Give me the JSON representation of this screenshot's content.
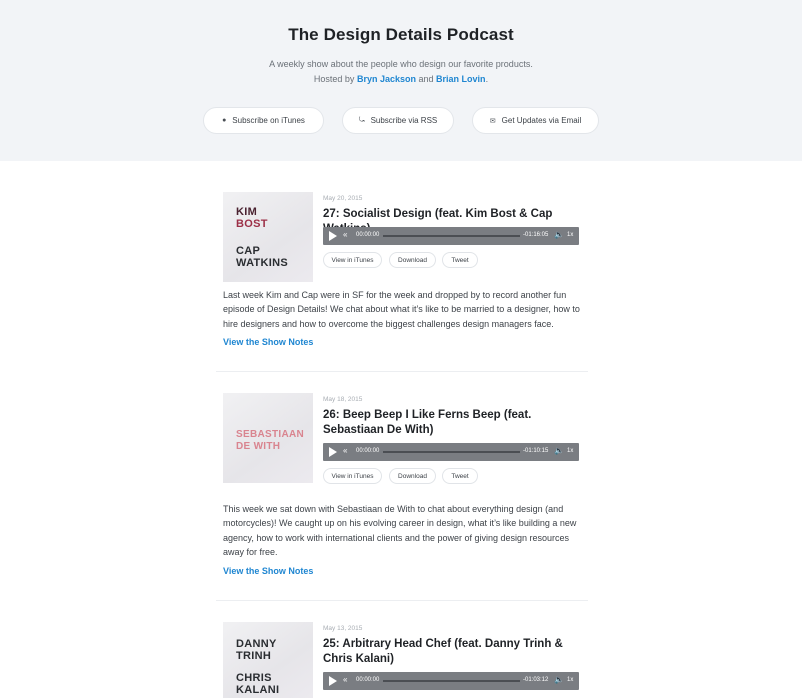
{
  "header": {
    "title": "The Design Details Podcast",
    "tagline": "A weekly show about the people who design our favorite products.",
    "hosted_by": "Hosted by",
    "host1": "Bryn Jackson",
    "and": "and",
    "host2": "Brian Lovin",
    "period": "."
  },
  "subscribe": [
    {
      "label": "Subscribe on iTunes",
      "icon": "microphone-icon",
      "glyph": "🎙"
    },
    {
      "label": "Subscribe via RSS",
      "icon": "rss-icon",
      "glyph": "⌔"
    },
    {
      "label": "Get Updates via Email",
      "icon": "envelope-icon",
      "glyph": "✉"
    }
  ],
  "episodes": [
    {
      "date": "May 20, 2015",
      "title": "27: Socialist Design (feat. Kim Bost & Cap Watkins)",
      "cover_lines_top": [
        "KIM",
        "BOST"
      ],
      "cover_lines_bottom": [
        "CAP",
        "WATKINS"
      ],
      "player": {
        "current": "00:00:00",
        "duration": "-01:16:05",
        "speed": "1x"
      },
      "actions": [
        "View in iTunes",
        "Download",
        "Tweet"
      ],
      "description": "Last week Kim and Cap were in SF for the week and dropped by to record another fun episode of Design Details! We chat about what it’s like to be married to a designer, how to hire designers and how to overcome the biggest challenges design managers face.",
      "notes_label": "View the Show Notes"
    },
    {
      "date": "May 18, 2015",
      "title": "26: Beep Beep I Like Ferns Beep (feat. Sebastiaan De With)",
      "cover_lines_top": [
        "SEBASTIAAN",
        "DE WITH"
      ],
      "player": {
        "current": "00:00:00",
        "duration": "-01:10:15",
        "speed": "1x"
      },
      "actions": [
        "View in iTunes",
        "Download",
        "Tweet"
      ],
      "description": "This week we sat down with Sebastiaan de With to chat about everything design (and motorcycles)! We caught up on his evolving career in design, what it’s like building a new agency, how to work with international clients and the power of giving design resources away for free.",
      "notes_label": "View the Show Notes"
    },
    {
      "date": "May 13, 2015",
      "title": "25: Arbitrary Head Chef (feat. Danny Trinh & Chris Kalani)",
      "cover_lines_top": [
        "DANNY",
        "TRINH"
      ],
      "cover_lines_bottom": [
        "CHRIS",
        "KALANI"
      ],
      "player": {
        "current": "00:00:00",
        "duration": "-01:03:12",
        "speed": "1x"
      }
    }
  ],
  "colors": {
    "accent": "#1f86d1",
    "hero_bg": "#f2f4f7",
    "player_bg": "#7a7d82",
    "cover_text_dark": "#4a2230",
    "cover_text_pink": "#d9848f"
  }
}
